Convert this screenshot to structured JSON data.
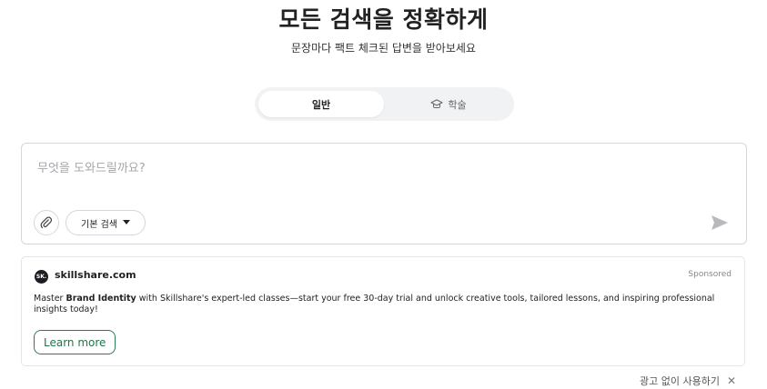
{
  "hero": {
    "title": "모든 검색을 정확하게",
    "subtitle": "문장마다 팩트 체크된 답변을 받아보세요"
  },
  "mode_toggle": {
    "tabs": [
      {
        "label": "일반",
        "active": true
      },
      {
        "label": "학술",
        "active": false,
        "icon": "graduation-cap-icon"
      }
    ]
  },
  "search": {
    "placeholder": "무엇을 도와드릴까요?",
    "value": "",
    "attach_icon": "paperclip-icon",
    "mode_label": "기본 검색",
    "mode_icon": "caret-down-icon",
    "send_icon": "send-arrow-icon"
  },
  "ad": {
    "logo_text": "SK.",
    "domain": "skillshare.com",
    "sponsored_label": "Sponsored",
    "body_prefix": "Master ",
    "body_bold": "Brand Identity",
    "body_suffix": " with Skillshare's expert-led classes—start your free 30-day trial and unlock creative tools, tailored lessons, and inspiring professional insights today!",
    "cta_label": "Learn more"
  },
  "footer": {
    "ad_free_label": "광고 없이 사용하기",
    "close_symbol": "✕"
  },
  "colors": {
    "accent_green": "#20744a",
    "toggle_bg": "#f1f2f3",
    "border": "#d5d7da"
  }
}
